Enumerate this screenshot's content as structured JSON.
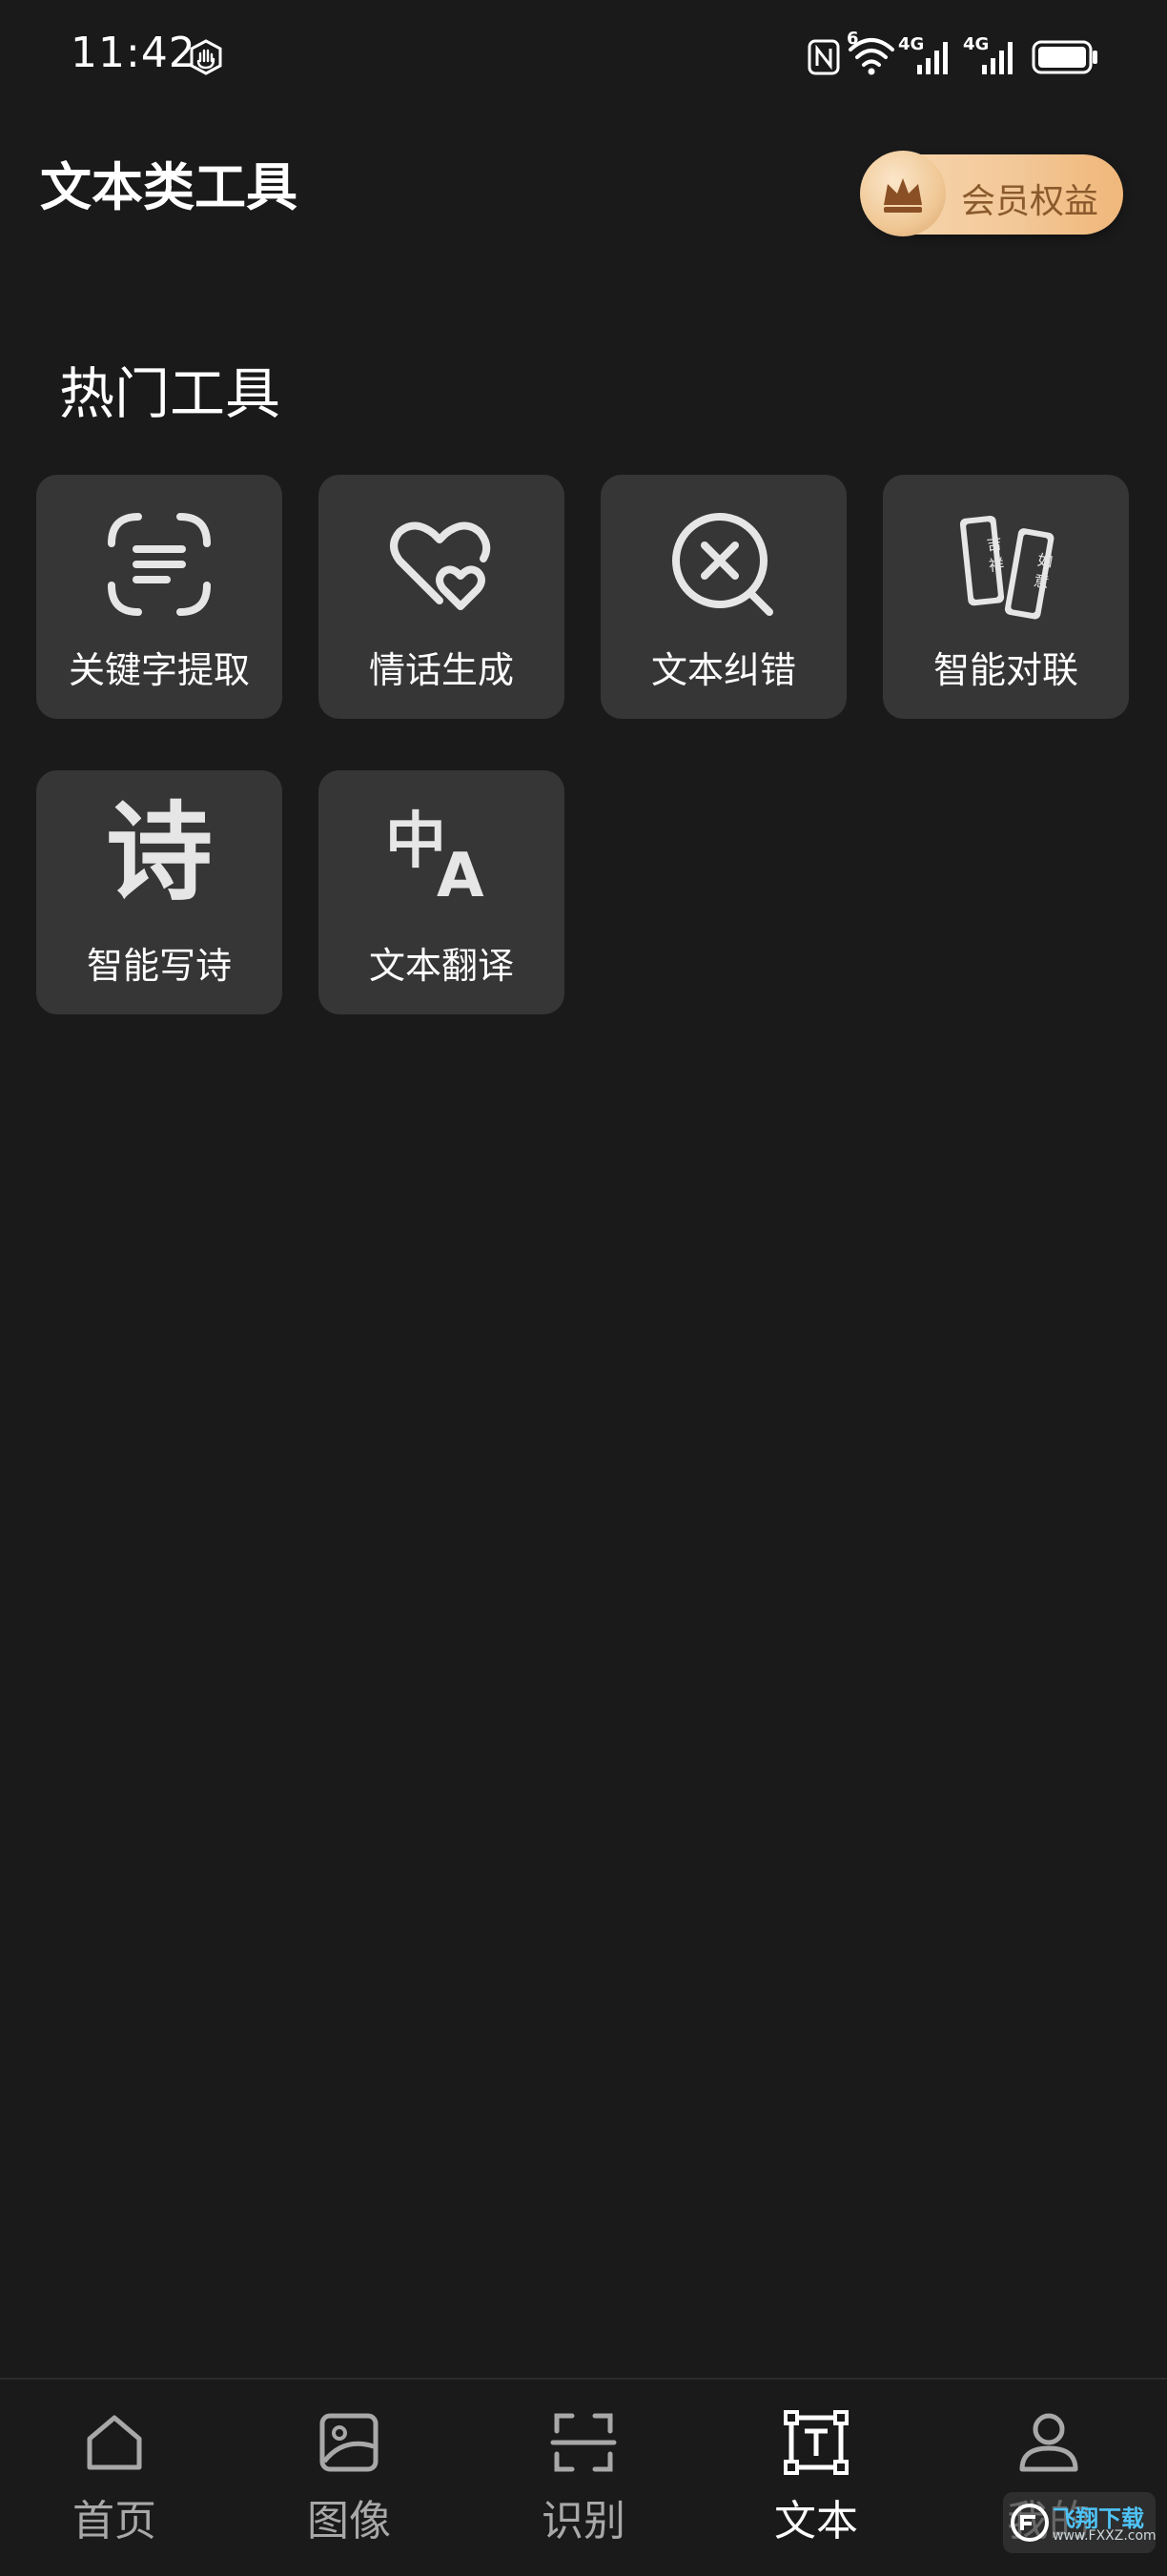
{
  "status_bar": {
    "time": "11:42",
    "icons": [
      "hand-shield-icon",
      "nfc-icon",
      "wifi-icon",
      "signal-4g-icon",
      "signal-4g-icon",
      "battery-icon"
    ],
    "net_label_1": "4G",
    "net_label_2": "4G",
    "wifi_label": "6"
  },
  "header": {
    "title": "文本类工具",
    "vip_label": "会员权益"
  },
  "section": {
    "title": "热门工具"
  },
  "tools": [
    {
      "label": "关键字提取",
      "icon": "scan-text-icon"
    },
    {
      "label": "情话生成",
      "icon": "hearts-icon"
    },
    {
      "label": "文本纠错",
      "icon": "search-close-icon"
    },
    {
      "label": "智能对联",
      "icon": "couplet-icon"
    },
    {
      "label": "智能写诗",
      "icon": "poem-icon"
    },
    {
      "label": "文本翻译",
      "icon": "translate-icon"
    }
  ],
  "couplet_icon": {
    "left_chars": "吉祥",
    "right_chars": "如意"
  },
  "poem_icon": {
    "glyph": "诗"
  },
  "translate_icon": {
    "glyph_left": "中",
    "glyph_right": "A"
  },
  "nav": [
    {
      "label": "首页",
      "icon": "home-icon",
      "active": false
    },
    {
      "label": "图像",
      "icon": "image-icon",
      "active": false
    },
    {
      "label": "识别",
      "icon": "scan-icon",
      "active": false
    },
    {
      "label": "文本",
      "icon": "text-icon",
      "active": true
    },
    {
      "label": "我的",
      "icon": "user-icon",
      "active": false
    }
  ],
  "watermark": {
    "title": "飞翔下载",
    "sub": "www.FXXZ.com"
  },
  "colors": {
    "background": "#1a1a1a",
    "card": "#363636",
    "vip_gradient_start": "#f7d8b2",
    "vip_gradient_end": "#f0b77a",
    "vip_text": "#8a5a2c",
    "nav_inactive": "#a8a8a8",
    "nav_active": "#ffffff"
  }
}
